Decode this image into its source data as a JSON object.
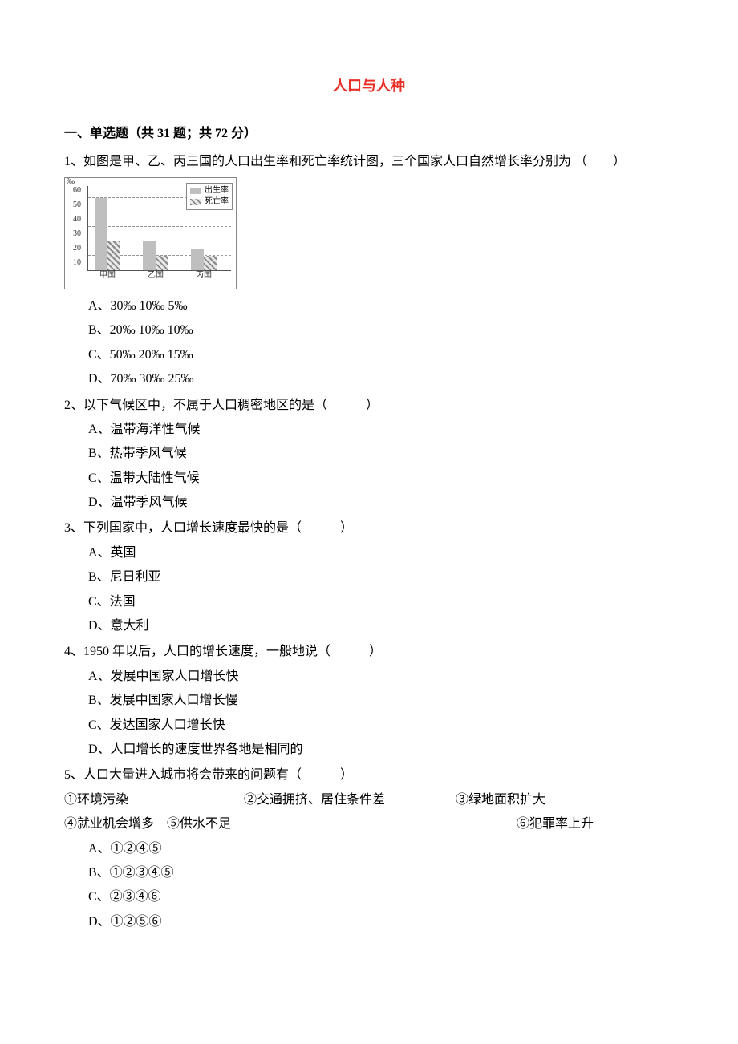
{
  "title": "人口与人种",
  "section_header": "一、单选题（共 31 题；共 72 分）",
  "chart_data": {
    "type": "bar",
    "categories": [
      "甲国",
      "乙国",
      "丙国"
    ],
    "series": [
      {
        "name": "出生率",
        "values": [
          50,
          20,
          15
        ]
      },
      {
        "name": "死亡率",
        "values": [
          20,
          10,
          10
        ]
      }
    ],
    "ylabel": "‰",
    "ylim": [
      0,
      60
    ],
    "yticks": [
      0,
      10,
      20,
      30,
      40,
      50,
      60
    ],
    "legend_labels": {
      "birth": "出生率",
      "death": "死亡率"
    }
  },
  "questions": [
    {
      "stem": "1、如图是甲、乙、丙三国的人口出生率和死亡率统计图，三个国家人口自然增长率分别为 （　　）",
      "options": [
        "A、30‰ 10‰ 5‰",
        "B、20‰ 10‰ 10‰",
        "C、50‰ 20‰ 15‰",
        "D、70‰ 30‰ 25‰"
      ]
    },
    {
      "stem": "2、以下气候区中，不属于人口稠密地区的是（　　　）",
      "options": [
        "A、温带海洋性气候",
        "B、热带季风气候",
        "C、温带大陆性气候",
        "D、温带季风气候"
      ]
    },
    {
      "stem": "3、下列国家中，人口增长速度最快的是（　　　）",
      "options": [
        "A、英国",
        "B、尼日利亚",
        "C、法国",
        "D、意大利"
      ]
    },
    {
      "stem": "4、1950 年以后，人口的增长速度，一般地说（　　　）",
      "options": [
        "A、发展中国家人口增长快",
        "B、发展中国家人口增长慢",
        "C、发达国家人口增长快",
        "D、人口增长的速度世界各地是相同的"
      ]
    },
    {
      "stem": "5、人口大量进入城市将会带来的问题有（　　　）",
      "inline_row1": [
        "①环境污染",
        "②交通拥挤、居住条件差",
        "③绿地面积扩大"
      ],
      "inline_row2": [
        "④就业机会增多　⑤供水不足",
        "⑥犯罪率上升"
      ],
      "options": [
        "A、①②④⑤",
        "B、①②③④⑤",
        "C、②③④⑥",
        "D、①②⑤⑥"
      ]
    }
  ]
}
